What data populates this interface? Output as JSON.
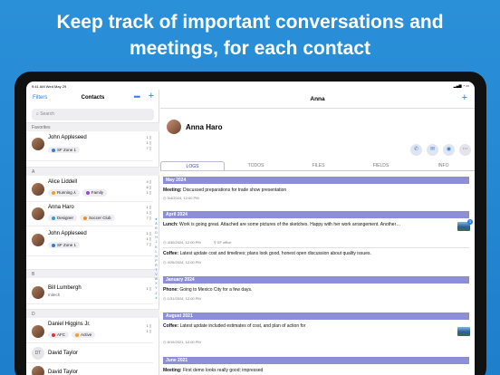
{
  "headline": {
    "line1": "Keep track of important conversations and",
    "line2": "meetings, for each contact"
  },
  "status_bar": {
    "time": "9:41 AM  Wed May 29",
    "indicators": "▂▄▆ ◔ ▭"
  },
  "sidebar": {
    "filters": "Filters",
    "title": "Contacts",
    "more": "•••",
    "add": "+",
    "search_placeholder": "Search",
    "sections": [
      "Favorites",
      "A",
      "B",
      "D"
    ],
    "contacts": [
      {
        "name": "John Appleseed",
        "tags": [
          {
            "label": "SF Zone 1",
            "color": "#2c7be5"
          }
        ],
        "counts": "1 ▯\n1 ▯\n7 ▯"
      },
      {
        "name": "Alice Liddell",
        "tags": [
          {
            "label": "Running",
            "color": "#f0a020"
          },
          {
            "label": "Family",
            "color": "#8a4fd0"
          }
        ],
        "counts": "4 ▯\n6 ▯\n1 ▯"
      },
      {
        "name": "Anna Haro",
        "tags": [
          {
            "label": "Designer",
            "color": "#34a0c8"
          },
          {
            "label": "Soccer Club",
            "color": "#e89020"
          }
        ],
        "counts": "1 ▯\n1 ▯\n7 ▯"
      },
      {
        "name": "John Appleseed",
        "tags": [
          {
            "label": "SF Zone 1",
            "color": "#2c7be5"
          }
        ],
        "counts": "1 ▯\n1 ▯\n7 ▯"
      },
      {
        "name": "Bill Lumbergh",
        "sub": "Initech",
        "counts": "1 ▯"
      },
      {
        "name": "Daniel Higgins Jr.",
        "tags": [
          {
            "label": "AFC",
            "color": "#e03030"
          },
          {
            "label": "Active",
            "color": "#f0a020"
          }
        ],
        "counts": "1 ▯\n1 ▯"
      },
      {
        "name": "David Taylor",
        "initials": "DT",
        "counts": ""
      },
      {
        "name": "David Taylor",
        "counts": ""
      }
    ],
    "alphabet": "★\nA\nB\nD\nH\nJ\nK\nL\nN\nP\nR\nT\nV\nW\nX\nY\nZ\n#"
  },
  "main": {
    "title": "Anna",
    "add": "+",
    "contact_name": "Anna Haro",
    "tabs": [
      "LOGS",
      "TODOS",
      "FILES",
      "FIELDS",
      "INFO"
    ],
    "months": [
      "May 2024",
      "April 2024",
      "January 2024",
      "August 2021",
      "June 2021"
    ],
    "logs": [
      {
        "kind": "Meeting:",
        "text": " Discussed preparations for trade show presentation",
        "date": "5/4/2024, 12:00 PM",
        "location": ""
      },
      {
        "kind": "Lunch:",
        "text": " Work is going great. Attached are some pictures of the sketches. Happy with her work arrangement. Another…",
        "date": "4/30/2024, 12:00 PM",
        "location": "SF office",
        "badge": "3"
      },
      {
        "kind": "Coffee:",
        "text": " Latest update cost and timelines; plans look good, honest open discussion about quality issues.",
        "date": "4/26/2024, 12:00 PM",
        "location": ""
      },
      {
        "kind": "Phone:",
        "text": " Going to Mexico City for a few days.",
        "date": "1/31/2024, 12:00 PM",
        "location": ""
      },
      {
        "kind": "Coffee:",
        "text": " Latest update included estimates of cost, and plan of action for",
        "date": "8/19/2021, 12:00 PM",
        "location": ""
      },
      {
        "kind": "Meeting:",
        "text": " First demo looks really good; impressed",
        "date": "",
        "location": ""
      }
    ]
  },
  "colors": {
    "accent": "#2c7be5",
    "month_header": "#8c8fd6",
    "background": "#2a90d8"
  }
}
